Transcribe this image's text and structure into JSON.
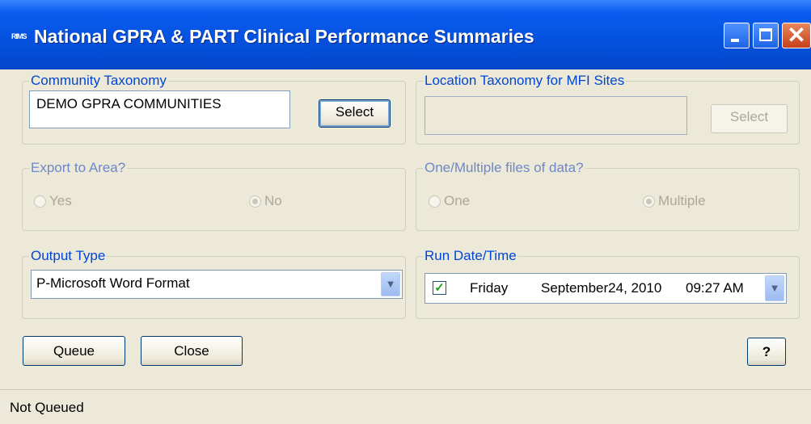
{
  "window": {
    "title": "National GPRA & PART Clinical Performance Summaries",
    "icon_label": "RIMS"
  },
  "community_taxonomy": {
    "legend": "Community Taxonomy",
    "value": "DEMO GPRA COMMUNITIES",
    "select_label": "Select"
  },
  "location_taxonomy": {
    "legend": "Location Taxonomy for MFI Sites",
    "value": "",
    "select_label": "Select"
  },
  "export_area": {
    "legend": "Export to Area?",
    "options": [
      {
        "label": "Yes",
        "selected": false
      },
      {
        "label": "No",
        "selected": true
      }
    ]
  },
  "files_of_data": {
    "legend": "One/Multiple files of data?",
    "options": [
      {
        "label": "One",
        "selected": false
      },
      {
        "label": "Multiple",
        "selected": true
      }
    ]
  },
  "output_type": {
    "legend": "Output Type",
    "selected": "P-Microsoft Word Format"
  },
  "run_datetime": {
    "legend": "Run Date/Time",
    "checked": true,
    "day": "Friday",
    "date": "September24, 2010",
    "time": "09:27 AM"
  },
  "buttons": {
    "queue": "Queue",
    "close": "Close",
    "help": "?"
  },
  "status": {
    "text": "Not Queued"
  },
  "colors": {
    "titlebar": "#0552e0",
    "group_label": "#0046d5",
    "window_bg": "#ece9d8"
  }
}
